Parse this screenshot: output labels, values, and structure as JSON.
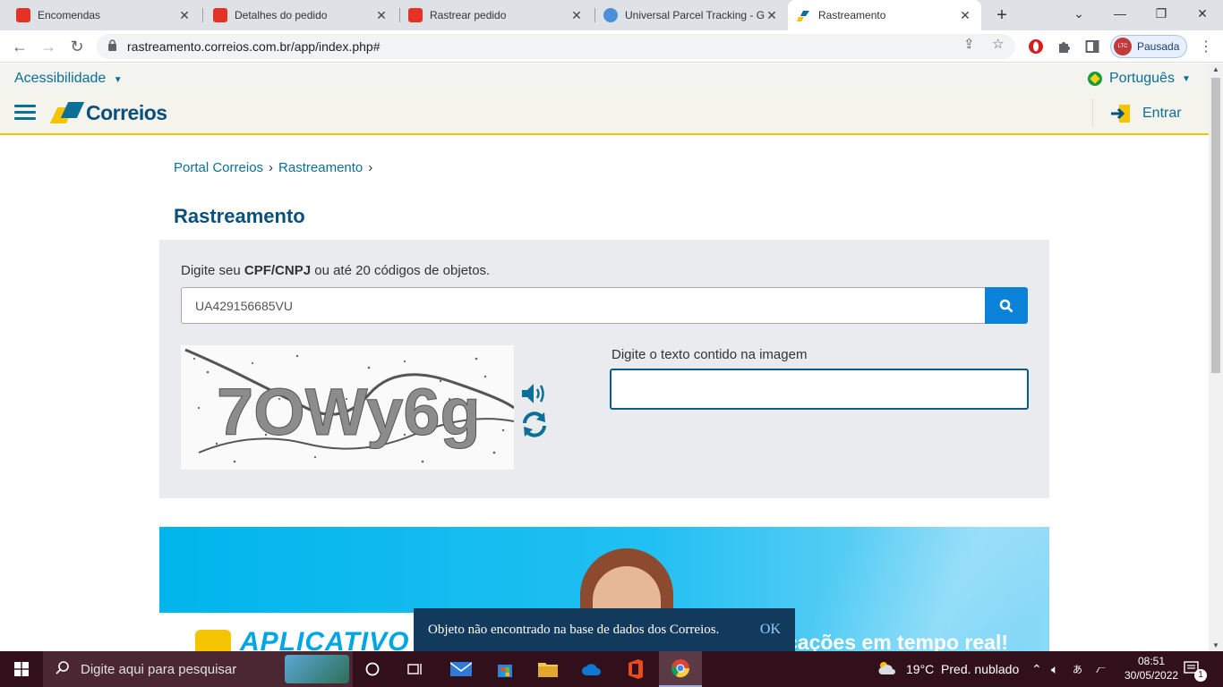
{
  "browser": {
    "tabs": [
      {
        "title": "Encomendas",
        "favicon": "aliexpress-icon",
        "color": "#e43225"
      },
      {
        "title": "Detalhes do pedido",
        "favicon": "aliexpress-icon",
        "color": "#e43225"
      },
      {
        "title": "Rastrear pedido",
        "favicon": "aliexpress-icon",
        "color": "#e43225"
      },
      {
        "title": "Universal Parcel Tracking - G",
        "favicon": "globe-icon",
        "color": "#4a8fd8"
      },
      {
        "title": "Rastreamento",
        "favicon": "correios-icon",
        "color": "#f5c400"
      }
    ],
    "new_tab": "+",
    "url": "rastreamento.correios.com.br/app/index.php#",
    "profile_label": "Pausada",
    "profile_avatar": "LTC"
  },
  "site": {
    "accessibility": "Acessibilidade",
    "language": "Português",
    "brand": "Correios",
    "login": "Entrar",
    "breadcrumb": [
      "Portal Correios",
      "Rastreamento"
    ],
    "page_title": "Rastreamento",
    "form": {
      "prompt_prefix": "Digite seu ",
      "prompt_bold": "CPF/CNPJ",
      "prompt_suffix": " ou até 20 códigos de objetos.",
      "code_value": "UA429156685VU",
      "captcha_text": "7OWy6g",
      "captcha_label": "Digite o texto contido na imagem",
      "captcha_value": ""
    },
    "banner": {
      "app_text": "APLICATIVO",
      "tagline": "cações em tempo real!"
    },
    "snackbar": {
      "message": "Objeto não encontrado na base de dados dos Correios.",
      "action": "OK"
    }
  },
  "taskbar": {
    "search_placeholder": "Digite aqui para pesquisar",
    "weather": "19°C  Pred. nublado",
    "time": "08:51",
    "date": "30/05/2022",
    "notifications": "1"
  },
  "colors": {
    "brand_blue": "#0b6f97",
    "brand_yellow": "#f5c400",
    "search_button": "#0b82d8",
    "snackbar": "#123a5c"
  }
}
